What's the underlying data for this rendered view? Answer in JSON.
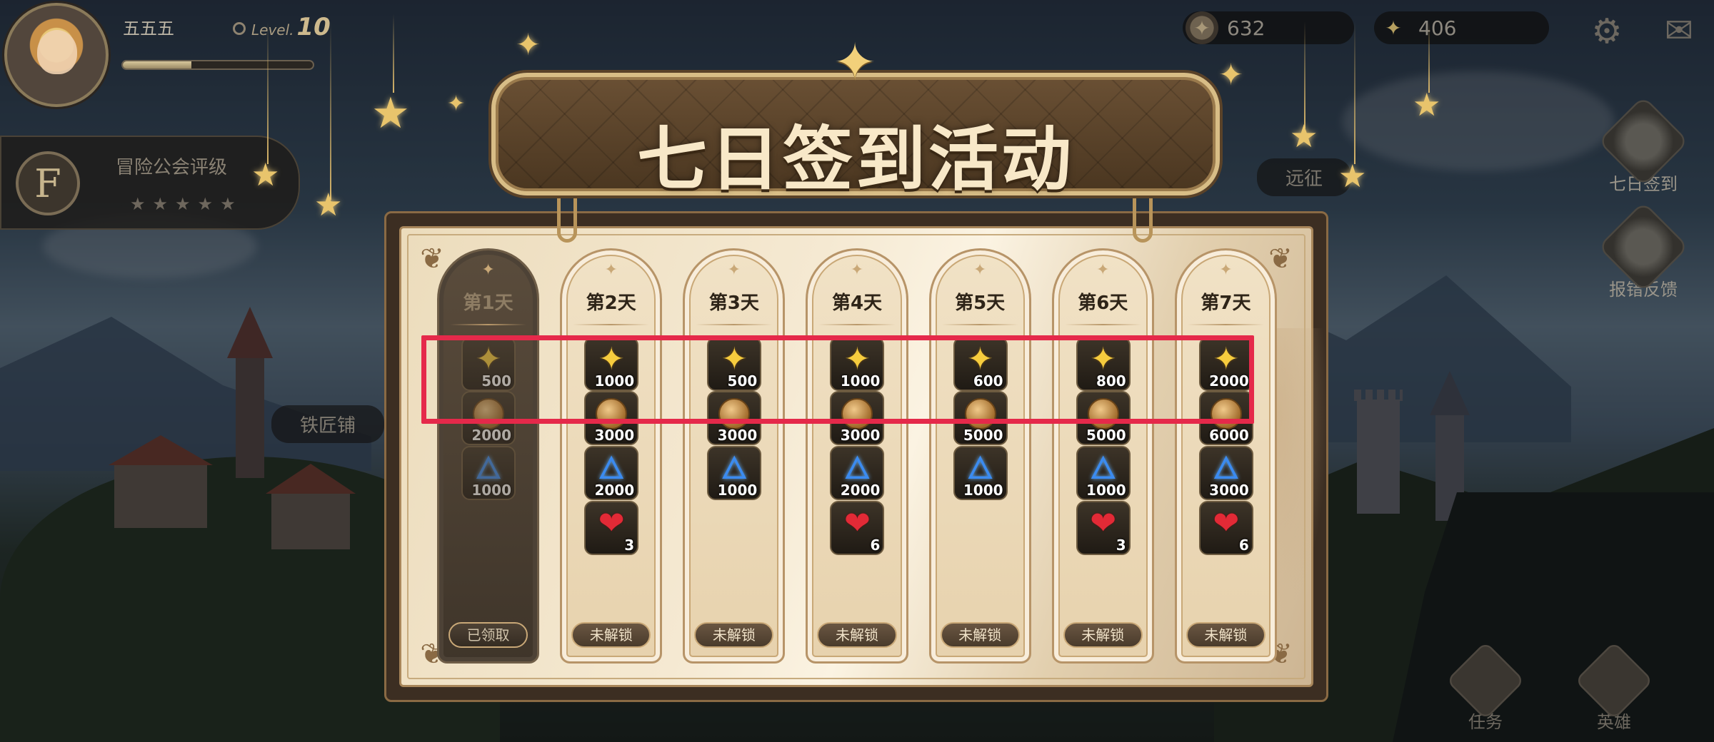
{
  "player": {
    "name": "五五五",
    "level_label": "Level.",
    "level": "10",
    "exp_fraction": 0.36
  },
  "guild": {
    "badge": "F",
    "label": "冒险公会评级",
    "stars": "★★★★★"
  },
  "currencies": [
    {
      "name": "coin",
      "icon": "coin-icon",
      "value": "632"
    },
    {
      "name": "gem",
      "icon": "gem-star-icon",
      "value": "406"
    }
  ],
  "top_icons": {
    "settings": "⚙",
    "mail": "✉"
  },
  "side_menu": [
    {
      "label": "七日签到",
      "icon": "gift-box-icon"
    },
    {
      "label": "报错反馈",
      "icon": "feedback-box-icon"
    }
  ],
  "map_labels": {
    "smithy": "铁匠铺",
    "expedition": "远征"
  },
  "bottom_menu": [
    {
      "label": "任务",
      "icon": "quest-icon"
    },
    {
      "label": "英雄",
      "icon": "helmet-icon"
    }
  ],
  "event": {
    "title": "七日签到活动",
    "days": [
      {
        "label": "第1天",
        "status": "已领取",
        "claimed": true,
        "rewards": [
          {
            "type": "gem",
            "amount": "500"
          },
          {
            "type": "coin",
            "amount": "2000"
          },
          {
            "type": "crystal",
            "amount": "1000"
          }
        ]
      },
      {
        "label": "第2天",
        "status": "未解锁",
        "claimed": false,
        "rewards": [
          {
            "type": "gem",
            "amount": "1000"
          },
          {
            "type": "coin",
            "amount": "3000"
          },
          {
            "type": "crystal",
            "amount": "2000"
          },
          {
            "type": "heart",
            "amount": "3"
          }
        ]
      },
      {
        "label": "第3天",
        "status": "未解锁",
        "claimed": false,
        "rewards": [
          {
            "type": "gem",
            "amount": "500"
          },
          {
            "type": "coin",
            "amount": "3000"
          },
          {
            "type": "crystal",
            "amount": "1000"
          }
        ]
      },
      {
        "label": "第4天",
        "status": "未解锁",
        "claimed": false,
        "rewards": [
          {
            "type": "gem",
            "amount": "1000"
          },
          {
            "type": "coin",
            "amount": "3000"
          },
          {
            "type": "crystal",
            "amount": "2000"
          },
          {
            "type": "heart",
            "amount": "6"
          }
        ]
      },
      {
        "label": "第5天",
        "status": "未解锁",
        "claimed": false,
        "rewards": [
          {
            "type": "gem",
            "amount": "600"
          },
          {
            "type": "coin",
            "amount": "5000"
          },
          {
            "type": "crystal",
            "amount": "1000"
          }
        ]
      },
      {
        "label": "第6天",
        "status": "未解锁",
        "claimed": false,
        "rewards": [
          {
            "type": "gem",
            "amount": "800"
          },
          {
            "type": "coin",
            "amount": "5000"
          },
          {
            "type": "crystal",
            "amount": "1000"
          },
          {
            "type": "heart",
            "amount": "3"
          }
        ]
      },
      {
        "label": "第7天",
        "status": "未解锁",
        "claimed": false,
        "rewards": [
          {
            "type": "gem",
            "amount": "2000"
          },
          {
            "type": "coin",
            "amount": "6000"
          },
          {
            "type": "crystal",
            "amount": "3000"
          },
          {
            "type": "heart",
            "amount": "6"
          }
        ]
      }
    ]
  },
  "colors": {
    "highlight": "#e5294a",
    "title_text": "#f8e8c8",
    "gold": "#f6cc3e"
  }
}
